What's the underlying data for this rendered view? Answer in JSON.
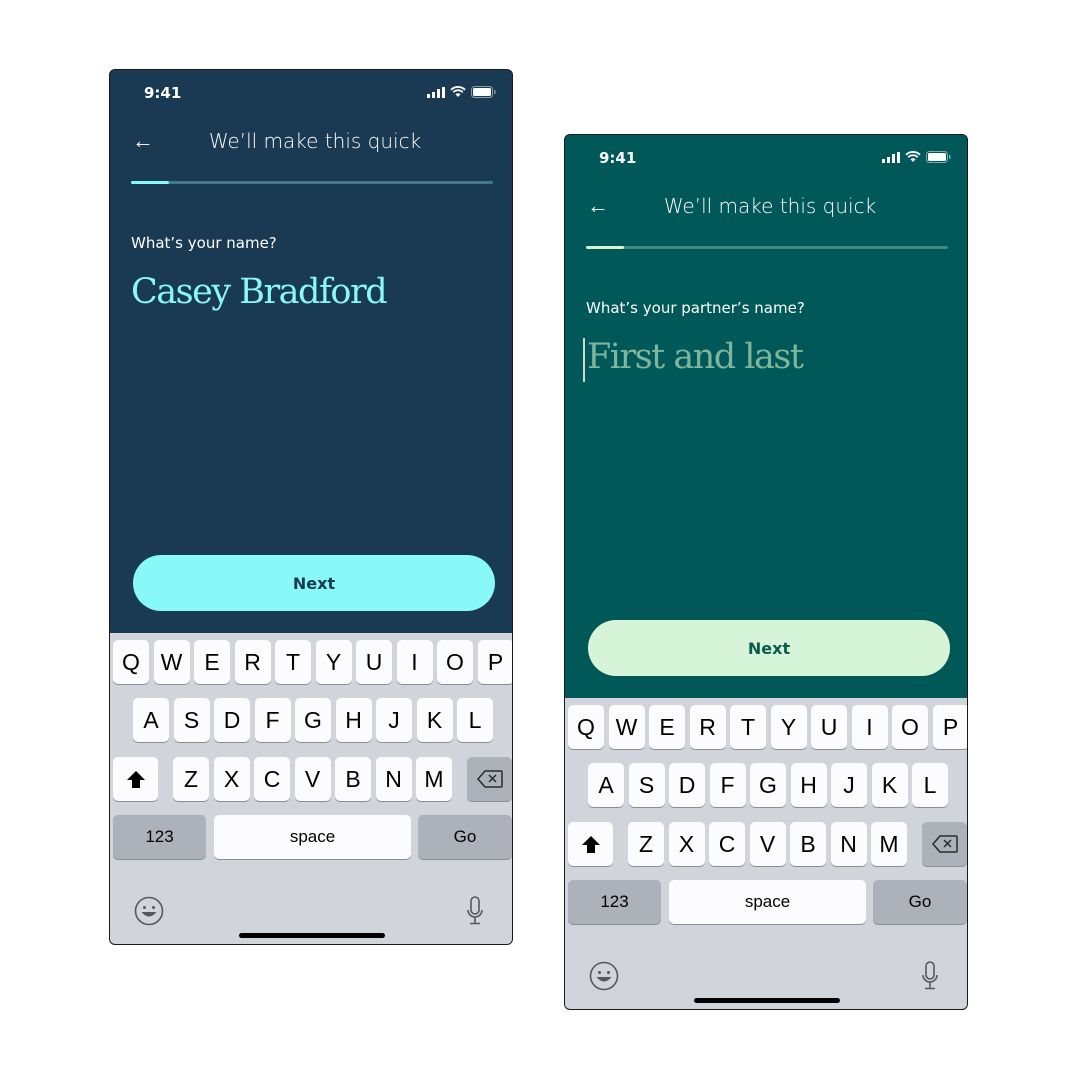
{
  "screens": [
    {
      "theme": {
        "background": "#193a52",
        "accent": "#88f9f8",
        "track": "#3f7a88",
        "button_bg": "#88f9f8",
        "button_text": "#193a52",
        "value_color": "#88f9f8"
      },
      "status_bar": {
        "time": "9:41",
        "icons": [
          "cellular-signal-icon",
          "wifi-icon",
          "battery-icon"
        ]
      },
      "header": {
        "back_icon": "←",
        "title": "We’ll make this quick"
      },
      "progress": {
        "fraction": 0.105
      },
      "field": {
        "label": "What’s your name?",
        "value": "Casey Bradford",
        "placeholder": ""
      },
      "next_button": {
        "label": "Next"
      },
      "keyboard": {
        "row1": [
          "Q",
          "W",
          "E",
          "R",
          "T",
          "Y",
          "U",
          "I",
          "O",
          "P"
        ],
        "row2": [
          "A",
          "S",
          "D",
          "F",
          "G",
          "H",
          "J",
          "K",
          "L"
        ],
        "row3": [
          "Z",
          "X",
          "C",
          "V",
          "B",
          "N",
          "M"
        ],
        "numbers_label": "123",
        "space_label": "space",
        "go_label": "Go"
      }
    },
    {
      "theme": {
        "background": "#015858",
        "accent": "#d6f5d8",
        "track": "#3f8a7d",
        "button_bg": "#d6f5d8",
        "button_text": "#0b5c4f",
        "value_color": "#7eb69d"
      },
      "status_bar": {
        "time": "9:41",
        "icons": [
          "cellular-signal-icon",
          "wifi-icon",
          "battery-icon"
        ]
      },
      "header": {
        "back_icon": "←",
        "title": "We’ll make this quick"
      },
      "progress": {
        "fraction": 0.105
      },
      "field": {
        "label": "What’s your partner’s name?",
        "value": "",
        "placeholder": "First and last"
      },
      "next_button": {
        "label": "Next"
      },
      "keyboard": {
        "row1": [
          "Q",
          "W",
          "E",
          "R",
          "T",
          "Y",
          "U",
          "I",
          "O",
          "P"
        ],
        "row2": [
          "A",
          "S",
          "D",
          "F",
          "G",
          "H",
          "J",
          "K",
          "L"
        ],
        "row3": [
          "Z",
          "X",
          "C",
          "V",
          "B",
          "N",
          "M"
        ],
        "numbers_label": "123",
        "space_label": "space",
        "go_label": "Go"
      }
    }
  ]
}
